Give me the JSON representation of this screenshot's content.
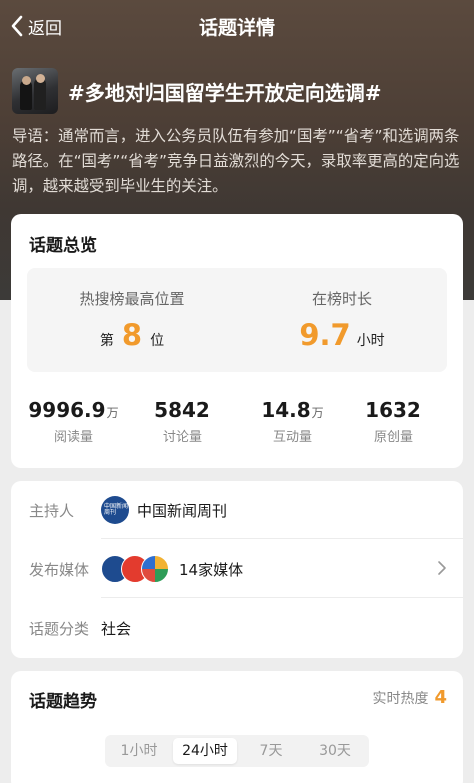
{
  "nav": {
    "back_label": "返回",
    "title": "话题详情"
  },
  "topic": {
    "title": "#多地对归国留学生开放定向选调#",
    "lead": "导语：通常而言，进入公务员队伍有参加“国考”“省考”和选调两条路径。在“国考”“省考”竞争日益激烈的今天，录取率更高的定向选调，越来越受到毕业生的关注。"
  },
  "overview": {
    "title": "话题总览",
    "rank": {
      "label": "热搜榜最高位置",
      "prefix": "第",
      "value": "8",
      "suffix": "位"
    },
    "duration": {
      "label": "在榜时长",
      "value": "9.7",
      "unit": "小时"
    },
    "stats": [
      {
        "value": "9996.9",
        "unit": "万",
        "label": "阅读量"
      },
      {
        "value": "5842",
        "unit": "",
        "label": "讨论量"
      },
      {
        "value": "14.8",
        "unit": "万",
        "label": "互动量"
      },
      {
        "value": "1632",
        "unit": "",
        "label": "原创量"
      }
    ],
    "accent_color": "#f19a2c"
  },
  "info": {
    "host_label": "主持人",
    "host_name": "中国新闻周刊",
    "host_logo_text": "中国新闻周刊",
    "media_label": "发布媒体",
    "media_count": "14家媒体",
    "category_label": "话题分类",
    "category": "社会"
  },
  "trend": {
    "title": "话题趋势",
    "heat_label": "实时热度",
    "heat_value": "4",
    "tabs": [
      "1小时",
      "24小时",
      "7天",
      "30天"
    ],
    "active_tab": "24小时"
  }
}
